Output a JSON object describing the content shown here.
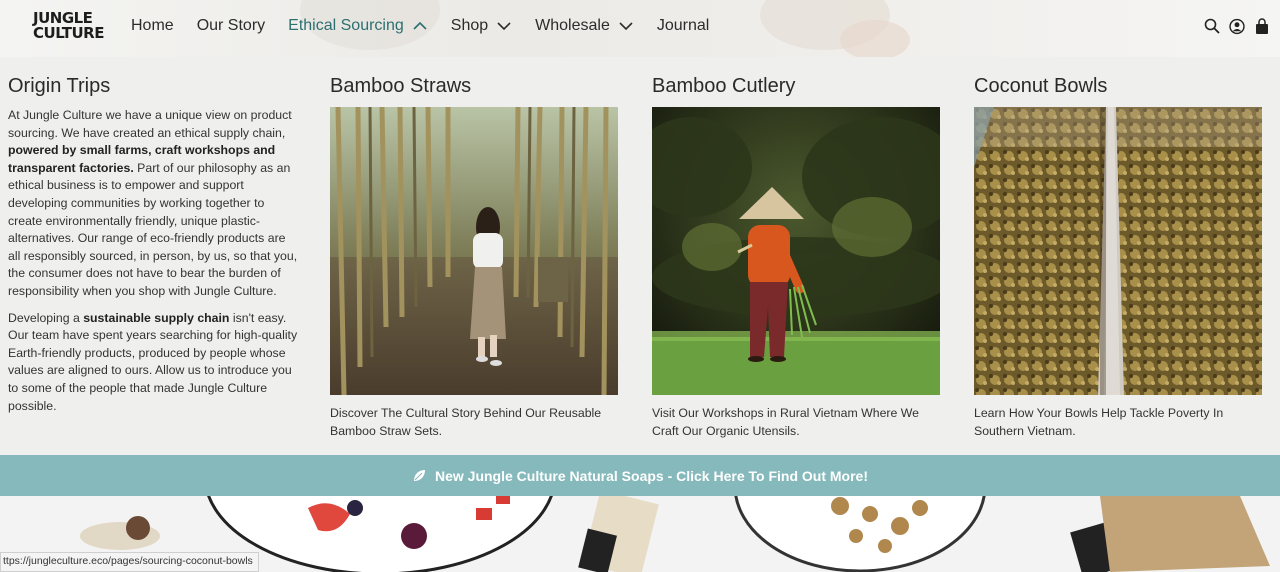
{
  "brand": {
    "logo_line1": "JUNGLE",
    "logo_line2": "CULTURE"
  },
  "nav": {
    "items": [
      {
        "label": "Home"
      },
      {
        "label": "Our Story"
      },
      {
        "label": "Ethical Sourcing"
      },
      {
        "label": "Shop"
      },
      {
        "label": "Wholesale"
      },
      {
        "label": "Journal"
      }
    ]
  },
  "header_icons": [
    "search-icon",
    "account-icon",
    "cart-icon"
  ],
  "mega_menu": {
    "origin": {
      "title": "Origin Trips",
      "p1_a": "At Jungle Culture we have a unique view on product sourcing. We have created an ethical supply chain, ",
      "p1_bold": "powered by small farms, craft workshops and transparent factories.",
      "p1_b": " Part of our philosophy as an ethical business is to empower and support developing communities by working together to create environmentally friendly, unique plastic-alternatives. Our range of eco-friendly products are all responsibly sourced, in person, by us, so that you, the consumer does not have to bear the burden of responsibility when you shop with Jungle Culture.",
      "p2_a": "Developing a ",
      "p2_bold": "sustainable supply chain",
      "p2_b": " isn't easy. Our team have spent years searching for high-quality Earth-friendly products, produced by people whose values are aligned to ours. Allow us to introduce you to some of the people that made Jungle Culture possible."
    },
    "cards": [
      {
        "title": "Bamboo Straws",
        "caption": "Discover The Cultural Story Behind Our Reusable Bamboo Straw Sets."
      },
      {
        "title": "Bamboo Cutlery",
        "caption": "Visit Our Workshops in Rural Vietnam Where We Craft Our Organic Utensils."
      },
      {
        "title": "Coconut Bowls",
        "caption": "Learn How Your Bowls Help Tackle Poverty In Southern Vietnam."
      }
    ]
  },
  "banner": {
    "text": "New Jungle Culture Natural Soaps - Click Here To Find Out More!"
  },
  "status_bar": {
    "url": "ttps://jungleculture.eco/pages/sourcing-coconut-bowls"
  },
  "colors": {
    "accent": "#2c6f70",
    "banner": "#86b9bb",
    "background": "#efefed"
  }
}
